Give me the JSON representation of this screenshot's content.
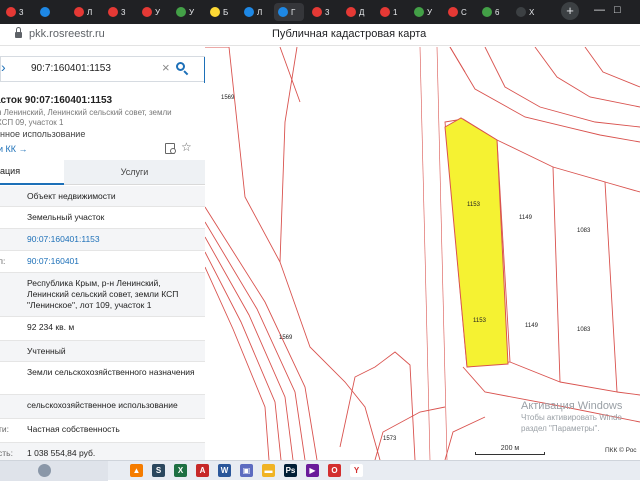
{
  "browser": {
    "tabs": [
      {
        "letter": "3",
        "fav_color": "#e53935",
        "active": false
      },
      {
        "letter": "",
        "fav_color": "#1e88e5",
        "active": false
      },
      {
        "letter": "Л",
        "fav_color": "#e53935",
        "active": false
      },
      {
        "letter": "3",
        "fav_color": "#e53935",
        "active": false
      },
      {
        "letter": "У",
        "fav_color": "#e53935",
        "active": false
      },
      {
        "letter": "У",
        "fav_color": "#43a047",
        "active": false
      },
      {
        "letter": "Б",
        "fav_color": "#fdd835",
        "active": false
      },
      {
        "letter": "Л",
        "fav_color": "#1e88e5",
        "active": false
      },
      {
        "letter": "Г",
        "fav_color": "#1e88e5",
        "active": true
      },
      {
        "letter": "3",
        "fav_color": "#e53935",
        "active": false
      },
      {
        "letter": "Д",
        "fav_color": "#e53935",
        "active": false
      },
      {
        "letter": "1",
        "fav_color": "#e53935",
        "active": false
      },
      {
        "letter": "У",
        "fav_color": "#43a047",
        "active": false
      },
      {
        "letter": "С",
        "fav_color": "#e53935",
        "active": false
      },
      {
        "letter": "6",
        "fav_color": "#43a047",
        "active": false
      },
      {
        "letter": "Х",
        "fav_color": "#3c4043",
        "active": false
      }
    ],
    "new_tab_label": "+",
    "url": "pkk.rosreestr.ru",
    "window_title": "Публичная кадастровая карта"
  },
  "panel": {
    "search": {
      "value": "90:7:160401:1153",
      "clear": "×"
    },
    "object_title": "асток 90:07:160401:1153",
    "object_subtitle": "н Ленинский, Ленинский сельский совет, земли КСП 09, участок 1",
    "usage": "енное использование",
    "kk_link": "и КК →",
    "tabs": {
      "info": "ация",
      "services": "Услуги"
    },
    "rows": [
      {
        "label": "",
        "value": "Объект недвижимости",
        "link": false
      },
      {
        "label": "",
        "value": "Земельный участок",
        "link": false
      },
      {
        "label": ":",
        "value": "90:07:160401:1153",
        "link": true
      },
      {
        "label": "л:",
        "value": "90:07:160401",
        "link": true
      },
      {
        "label": "",
        "value": "Республика Крым, р-н Ленинский, Ленинский сельский совет, земли КСП \"Ленинское\", лот 109, участок 1",
        "link": false
      },
      {
        "label": "",
        "value": "92 234 кв. м",
        "link": false
      },
      {
        "label": "",
        "value": "Учтенный",
        "link": false
      },
      {
        "label": "",
        "value": "Земли сельскохозяйственного назначения",
        "link": false
      },
      {
        "label": "",
        "value": "сельскохозяйственное использование",
        "link": false
      },
      {
        "label": "ти:",
        "value": "Частная собственность",
        "link": false
      },
      {
        "label": "сть:",
        "value": "1 038 554,84 руб.",
        "link": false
      }
    ]
  },
  "map": {
    "parcel_labels": [
      {
        "text": "1569",
        "id": "1569-top"
      },
      {
        "text": "1153",
        "id": "1153-upper"
      },
      {
        "text": "1149",
        "id": "1149-upper"
      },
      {
        "text": "1083",
        "id": "1083-upper"
      },
      {
        "text": "1153",
        "id": "1153-lower"
      },
      {
        "text": "1149",
        "id": "1149-lower"
      },
      {
        "text": "1083",
        "id": "1083-lower"
      },
      {
        "text": "1569",
        "id": "1569-lower"
      },
      {
        "text": "1573",
        "id": "1573"
      }
    ],
    "highlight_color": "#f5f232",
    "boundary_color": "#d9534f",
    "watermark": {
      "line1": "Активация Windows",
      "line2": "Чтобы активировать Windo",
      "line3": "раздел \"Параметры\"."
    },
    "scale_label": "200 м",
    "copyright": "ПКК © Рос"
  },
  "taskbar": {
    "icons": [
      {
        "name": "vlc-icon",
        "glyph": "▲",
        "color": "#f57c00"
      },
      {
        "name": "steam-icon",
        "glyph": "S",
        "color": "#2a475e"
      },
      {
        "name": "excel-icon",
        "glyph": "X",
        "color": "#1d6f42"
      },
      {
        "name": "pdf-icon",
        "glyph": "A",
        "color": "#c62828"
      },
      {
        "name": "word-icon",
        "glyph": "W",
        "color": "#2b579a"
      },
      {
        "name": "photo-icon",
        "glyph": "▣",
        "color": "#5c6bc0"
      },
      {
        "name": "folder-icon",
        "glyph": "▬",
        "color": "#f0b323"
      },
      {
        "name": "ps-icon",
        "glyph": "Ps",
        "color": "#001e36"
      },
      {
        "name": "media-icon",
        "glyph": "▶",
        "color": "#6a1b9a"
      },
      {
        "name": "opera-icon",
        "glyph": "O",
        "color": "#d32f2f"
      },
      {
        "name": "yandex-icon",
        "glyph": "Y",
        "color": "#ffffff"
      }
    ]
  }
}
